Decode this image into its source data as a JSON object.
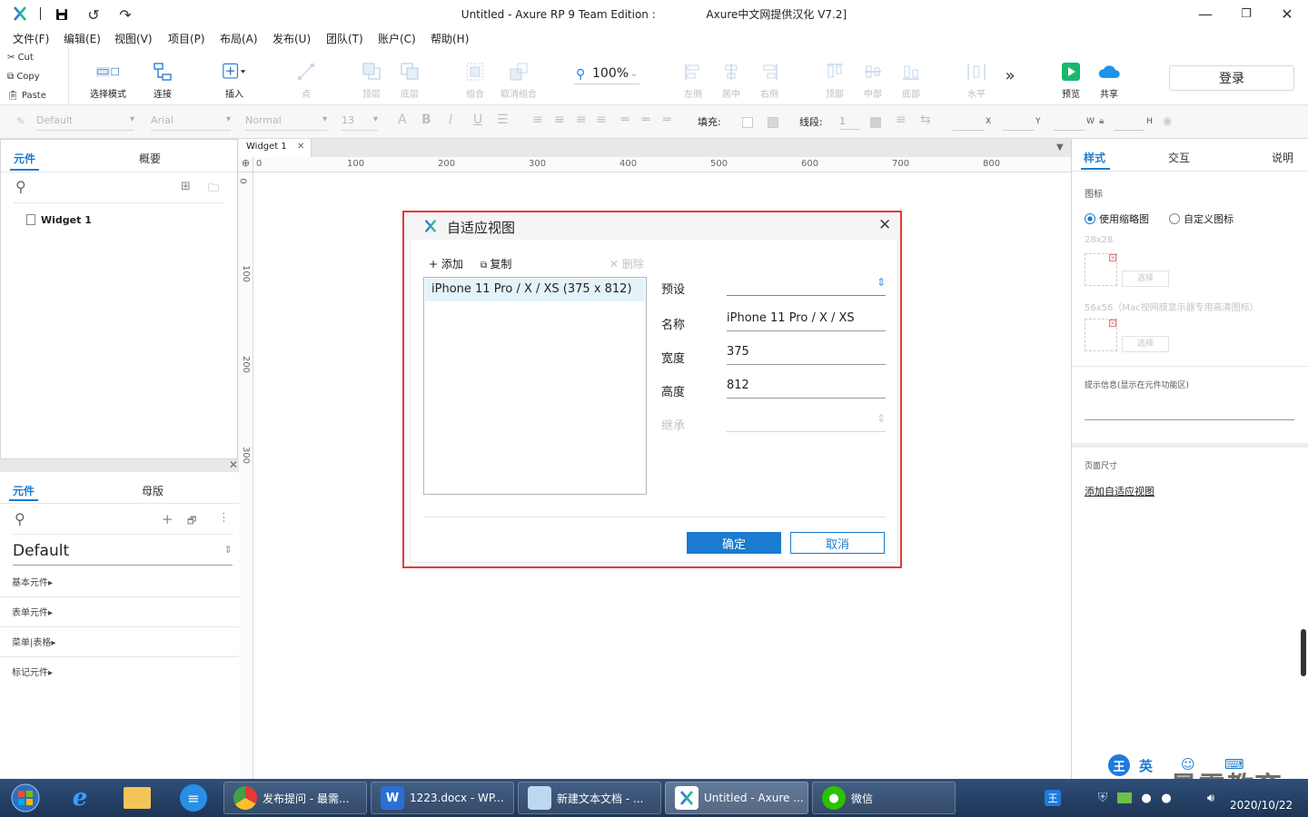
{
  "window": {
    "title": "Untitled - Axure RP 9 Team Edition :",
    "title_suffix": "Axure中文网提供汉化 V7.2]"
  },
  "menu": [
    "文件(F)",
    "编辑(E)",
    "视图(V)",
    "项目(P)",
    "布局(A)",
    "发布(U)",
    "团队(T)",
    "账户(C)",
    "帮助(H)"
  ],
  "clipboard": {
    "cut": "Cut",
    "copy": "Copy",
    "paste": "Paste"
  },
  "toolbar": {
    "select_mode": "选择模式",
    "connect": "连接",
    "insert": "插入",
    "point": "点",
    "top_layer": "顶层",
    "bottom_layer": "底层",
    "group": "组合",
    "ungroup": "取消组合",
    "zoom": "100%",
    "align_left": "左侧",
    "align_center": "居中",
    "align_right": "右侧",
    "align_top": "顶部",
    "align_middle": "中部",
    "align_bottom": "底部",
    "horizontal": "水平",
    "preview": "预览",
    "share": "共享",
    "login": "登录"
  },
  "format": {
    "style": "Default",
    "font": "Arial",
    "weight": "Normal",
    "size": "13",
    "fill_label": "填充:",
    "line_label": "线段:",
    "line_value": "1",
    "x": "X",
    "y": "Y",
    "w": "W",
    "h": "H"
  },
  "left_top": {
    "tabs": [
      "元件",
      "概要"
    ],
    "pages": [
      "Widget 1"
    ]
  },
  "left_bottom": {
    "tabs": [
      "元件",
      "母版"
    ],
    "library": "Default",
    "sections": [
      "基本元件▸",
      "表单元件▸",
      "菜单|表格▸",
      "标记元件▸"
    ]
  },
  "canvas": {
    "tab": "Widget 1",
    "ruler_h": [
      "0",
      "100",
      "200",
      "300",
      "400",
      "500",
      "600",
      "700",
      "800"
    ],
    "ruler_v": [
      "0",
      "100",
      "200",
      "300"
    ]
  },
  "dialog": {
    "title": "自适应视图",
    "add": "添加",
    "copy": "复制",
    "delete": "删除",
    "list": [
      "iPhone 11 Pro / X / XS (375 x 812)"
    ],
    "preset_label": "预设",
    "name_label": "名称",
    "name_value": "iPhone 11 Pro / X / XS",
    "width_label": "宽度",
    "width_value": "375",
    "height_label": "高度",
    "height_value": "812",
    "inherit_label": "继承",
    "ok": "确定",
    "cancel": "取消"
  },
  "right": {
    "tabs": [
      "样式",
      "交互",
      "说明"
    ],
    "icon_heading": "图标",
    "radio_thumb": "使用缩略图",
    "radio_custom": "自定义图标",
    "size1": "28x28",
    "size2": "56x56（Mac视网膜显示器专用高清图标）",
    "select": "选择",
    "tooltip": "提示信息(显示在元件功能区)",
    "page_size": "页面尺寸",
    "add_view": "添加自适应视图"
  },
  "taskbar": {
    "items": [
      "发布提问 - 最需...",
      "1223.docx - WP...",
      "新建文本文档 - ...",
      "Untitled - Axure ...",
      "微信"
    ],
    "ime": [
      "王",
      "英"
    ],
    "date": "2020/10/22",
    "watermark": "最需教育"
  },
  "colors": {
    "accent": "#1a7bd0",
    "dialog_border": "#e53935",
    "preview_green": "#19b86c",
    "share_blue": "#1f93e6"
  }
}
